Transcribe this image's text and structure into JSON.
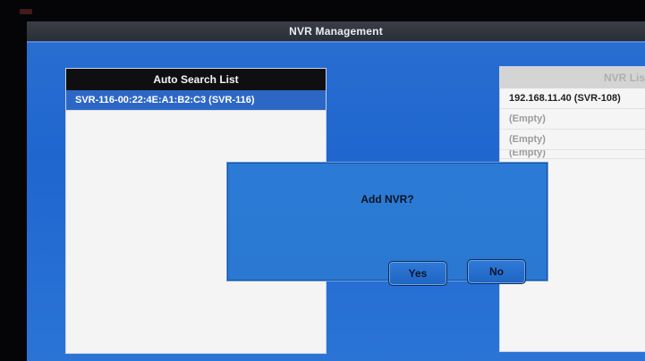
{
  "window": {
    "title": "NVR Management"
  },
  "auto_search": {
    "header": "Auto Search List",
    "items": [
      {
        "label": "SVR-116-00:22:4E:A1:B2:C3 (SVR-116)",
        "selected": true
      }
    ]
  },
  "nvr_list": {
    "header": "NVR List",
    "rows": [
      {
        "label": "192.168.11.40 (SVR-108)"
      },
      {
        "label": "(Empty)"
      },
      {
        "label": "(Empty)"
      },
      {
        "label": "(Empty)"
      }
    ]
  },
  "dialog": {
    "message": "Add NVR?",
    "yes_label": "Yes",
    "no_label": "No"
  },
  "colors": {
    "background_blue": "#1f66cf",
    "selection_blue": "#2d67c6",
    "titlebar_dark": "#2a2e35"
  }
}
